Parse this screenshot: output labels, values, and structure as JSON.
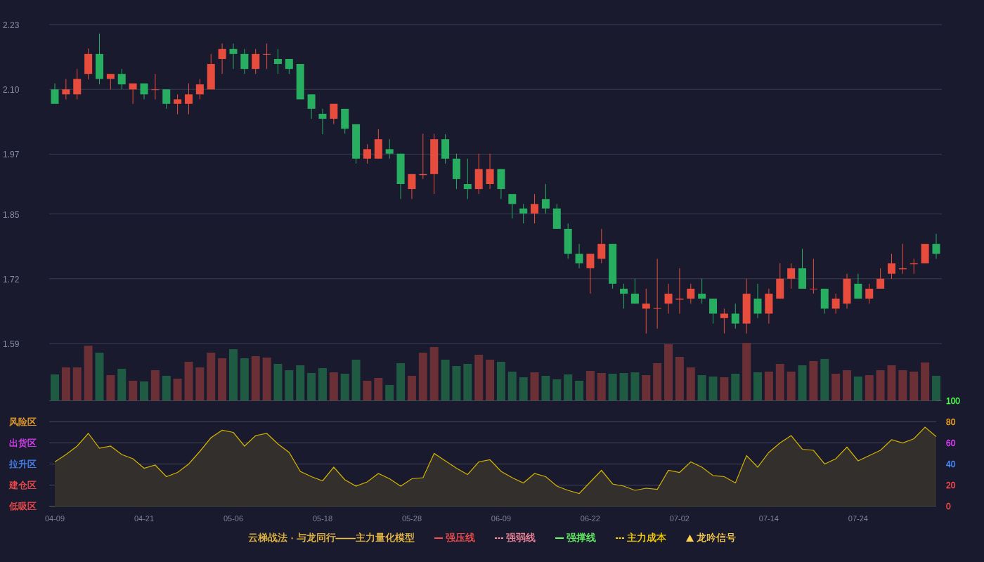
{
  "price_panel": {
    "chart_data": {
      "type": "candlestick",
      "ylim": [
        1.59,
        2.23
      ],
      "yticks": [
        {
          "value": 1.59,
          "label": "1.59"
        },
        {
          "value": 1.72,
          "label": "1.72"
        },
        {
          "value": 1.85,
          "label": "1.85"
        },
        {
          "value": 1.97,
          "label": "1.97"
        },
        {
          "value": 2.1,
          "label": "2.10"
        },
        {
          "value": 2.23,
          "label": "2.23"
        }
      ],
      "grid": true,
      "ohlc": [
        [
          2.1,
          2.112,
          2.071,
          2.071
        ],
        [
          2.09,
          2.121,
          2.08,
          2.1
        ],
        [
          2.09,
          2.141,
          2.08,
          2.121
        ],
        [
          2.131,
          2.182,
          2.12,
          2.171
        ],
        [
          2.171,
          2.212,
          2.11,
          2.121
        ],
        [
          2.121,
          2.131,
          2.1,
          2.131
        ],
        [
          2.131,
          2.141,
          2.1,
          2.11
        ],
        [
          2.1,
          2.112,
          2.071,
          2.112
        ],
        [
          2.112,
          2.112,
          2.08,
          2.09
        ],
        [
          2.1,
          2.131,
          2.08,
          2.1
        ],
        [
          2.1,
          2.1,
          2.061,
          2.071
        ],
        [
          2.071,
          2.09,
          2.05,
          2.08
        ],
        [
          2.071,
          2.112,
          2.05,
          2.09
        ],
        [
          2.09,
          2.121,
          2.08,
          2.11
        ],
        [
          2.1,
          2.171,
          2.1,
          2.151
        ],
        [
          2.161,
          2.192,
          2.131,
          2.181
        ],
        [
          2.181,
          2.192,
          2.141,
          2.171
        ],
        [
          2.171,
          2.181,
          2.131,
          2.141
        ],
        [
          2.141,
          2.181,
          2.131,
          2.171
        ],
        [
          2.171,
          2.192,
          2.141,
          2.171
        ],
        [
          2.161,
          2.181,
          2.131,
          2.151
        ],
        [
          2.161,
          2.161,
          2.131,
          2.141
        ],
        [
          2.151,
          2.151,
          2.08,
          2.08
        ],
        [
          2.09,
          2.09,
          2.041,
          2.061
        ],
        [
          2.051,
          2.061,
          2.01,
          2.041
        ],
        [
          2.041,
          2.071,
          2.03,
          2.071
        ],
        [
          2.061,
          2.061,
          2.011,
          2.021
        ],
        [
          2.03,
          2.03,
          1.951,
          1.961
        ],
        [
          1.961,
          1.99,
          1.951,
          1.98
        ],
        [
          1.961,
          2.02,
          1.961,
          2.0
        ],
        [
          1.98,
          2.0,
          1.961,
          1.971
        ],
        [
          1.971,
          1.971,
          1.88,
          1.91
        ],
        [
          1.9,
          1.93,
          1.88,
          1.93
        ],
        [
          1.928,
          2.011,
          1.92,
          1.93
        ],
        [
          1.93,
          2.011,
          1.89,
          2.0
        ],
        [
          2.0,
          2.01,
          1.951,
          1.961
        ],
        [
          1.961,
          1.971,
          1.9,
          1.92
        ],
        [
          1.91,
          1.961,
          1.88,
          1.9
        ],
        [
          1.9,
          1.971,
          1.89,
          1.94
        ],
        [
          1.91,
          1.971,
          1.9,
          1.94
        ],
        [
          1.94,
          1.94,
          1.88,
          1.9
        ],
        [
          1.89,
          1.89,
          1.841,
          1.87
        ],
        [
          1.861,
          1.87,
          1.831,
          1.851
        ],
        [
          1.851,
          1.89,
          1.831,
          1.87
        ],
        [
          1.88,
          1.91,
          1.851,
          1.861
        ],
        [
          1.861,
          1.87,
          1.82,
          1.82
        ],
        [
          1.82,
          1.831,
          1.76,
          1.77
        ],
        [
          1.77,
          1.79,
          1.741,
          1.751
        ],
        [
          1.741,
          1.77,
          1.69,
          1.77
        ],
        [
          1.76,
          1.82,
          1.751,
          1.79
        ],
        [
          1.79,
          1.79,
          1.7,
          1.71
        ],
        [
          1.7,
          1.71,
          1.66,
          1.69
        ],
        [
          1.69,
          1.72,
          1.67,
          1.67
        ],
        [
          1.66,
          1.7,
          1.61,
          1.67
        ],
        [
          1.66,
          1.76,
          1.62,
          1.661
        ],
        [
          1.67,
          1.71,
          1.65,
          1.69
        ],
        [
          1.678,
          1.741,
          1.65,
          1.68
        ],
        [
          1.68,
          1.71,
          1.67,
          1.7
        ],
        [
          1.69,
          1.72,
          1.67,
          1.68
        ],
        [
          1.68,
          1.68,
          1.63,
          1.65
        ],
        [
          1.641,
          1.66,
          1.61,
          1.65
        ],
        [
          1.65,
          1.67,
          1.62,
          1.63
        ],
        [
          1.63,
          1.72,
          1.61,
          1.69
        ],
        [
          1.68,
          1.71,
          1.641,
          1.65
        ],
        [
          1.65,
          1.7,
          1.63,
          1.69
        ],
        [
          1.68,
          1.751,
          1.68,
          1.72
        ],
        [
          1.72,
          1.751,
          1.7,
          1.741
        ],
        [
          1.741,
          1.78,
          1.7,
          1.7
        ],
        [
          1.699,
          1.76,
          1.69,
          1.7
        ],
        [
          1.7,
          1.7,
          1.65,
          1.66
        ],
        [
          1.66,
          1.69,
          1.65,
          1.68
        ],
        [
          1.67,
          1.73,
          1.66,
          1.72
        ],
        [
          1.71,
          1.73,
          1.68,
          1.68
        ],
        [
          1.68,
          1.71,
          1.67,
          1.7
        ],
        [
          1.7,
          1.741,
          1.7,
          1.72
        ],
        [
          1.73,
          1.77,
          1.72,
          1.751
        ],
        [
          1.739,
          1.79,
          1.73,
          1.741
        ],
        [
          1.749,
          1.76,
          1.73,
          1.751
        ],
        [
          1.751,
          1.79,
          1.751,
          1.79
        ],
        [
          1.79,
          1.81,
          1.76,
          1.77
        ]
      ]
    }
  },
  "indicator_panel": {
    "zones": [
      {
        "label": "风险区",
        "color": "#f5a623"
      },
      {
        "label": "出货区",
        "color": "#e040fb"
      },
      {
        "label": "拉升区",
        "color": "#4a8cff"
      },
      {
        "label": "建仓区",
        "color": "#ff4d4d"
      },
      {
        "label": "低吸区",
        "color": "#ff4d4d"
      }
    ],
    "tick_styles": [
      {
        "color": "#ff4d4d"
      },
      {
        "color": "#ff4d4d"
      },
      {
        "color": "#4a8cff"
      },
      {
        "color": "#e040fb"
      },
      {
        "color": "#f5a623"
      },
      {
        "color": "#4cff4c"
      }
    ],
    "date_labels": [
      "04-09",
      "04-21",
      "05-06",
      "05-18",
      "05-28",
      "06-09",
      "06-22",
      "07-02",
      "07-14",
      "07-24"
    ],
    "chart_data": {
      "type": "area",
      "ylim": [
        0,
        100
      ],
      "yticks": [
        0,
        20,
        40,
        60,
        80,
        100
      ],
      "grid": true,
      "series": [
        {
          "color": "#d4b400",
          "values": [
            42,
            49,
            57,
            69,
            55,
            57,
            49,
            45,
            36,
            39,
            28,
            32,
            40,
            52,
            65,
            72,
            70,
            57,
            67,
            69,
            59,
            51,
            33,
            28,
            24,
            37,
            25,
            19,
            23,
            31,
            26,
            19,
            26,
            27,
            50,
            43,
            36,
            30,
            42,
            44,
            33,
            27,
            22,
            31,
            28,
            19,
            15,
            12,
            23,
            34,
            21,
            19,
            15,
            17,
            16,
            34,
            32,
            42,
            37,
            29,
            28,
            22,
            48,
            37,
            51,
            60,
            67,
            54,
            53,
            40,
            45,
            56,
            43,
            48,
            53,
            63,
            60,
            64,
            75,
            66
          ]
        }
      ]
    }
  },
  "legend": [
    {
      "kind": "none",
      "label": "云梯战法 · 与龙同行——主力量化模型",
      "color": "#f0c040"
    },
    {
      "kind": "solid",
      "label": "强压线",
      "color": "#ff4d4d"
    },
    {
      "kind": "dashed",
      "label": "强弱线",
      "color": "#ff8ca0"
    },
    {
      "kind": "solid",
      "label": "强撑线",
      "color": "#66ff66"
    },
    {
      "kind": "dashed",
      "label": "主力成本",
      "color": "#ffd700"
    },
    {
      "kind": "triangle",
      "label": "龙吟信号",
      "color": "#ffd24a"
    }
  ]
}
